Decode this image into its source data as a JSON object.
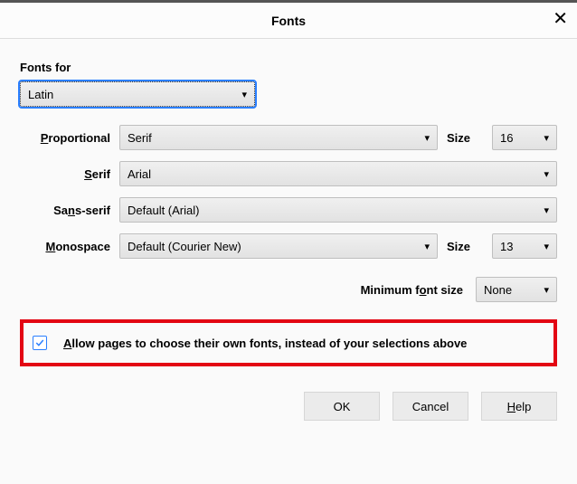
{
  "dialog": {
    "title": "Fonts"
  },
  "fonts_for_label": "Fonts for",
  "language": "Latin",
  "rows": {
    "proportional": {
      "label_pre": "",
      "label_u": "P",
      "label_post": "roportional",
      "value": "Serif",
      "size_label": "Size",
      "size_value": "16"
    },
    "serif": {
      "label_pre": "",
      "label_u": "S",
      "label_post": "erif",
      "value": "Arial"
    },
    "sans": {
      "label_pre": "Sa",
      "label_u": "n",
      "label_post": "s-serif",
      "value": "Default (Arial)"
    },
    "mono": {
      "label_pre": "",
      "label_u": "M",
      "label_post": "onospace",
      "value": "Default (Courier New)",
      "size_label": "Size",
      "size_value": "13"
    }
  },
  "min_font": {
    "label_pre": "Minimum f",
    "label_u": "o",
    "label_post": "nt size",
    "value": "None"
  },
  "allow": {
    "checked": true,
    "label_pre": "",
    "label_u": "A",
    "label_post": "llow pages to choose their own fonts, instead of your selections above"
  },
  "buttons": {
    "ok": "OK",
    "cancel": "Cancel",
    "help_u": "H",
    "help_post": "elp"
  }
}
